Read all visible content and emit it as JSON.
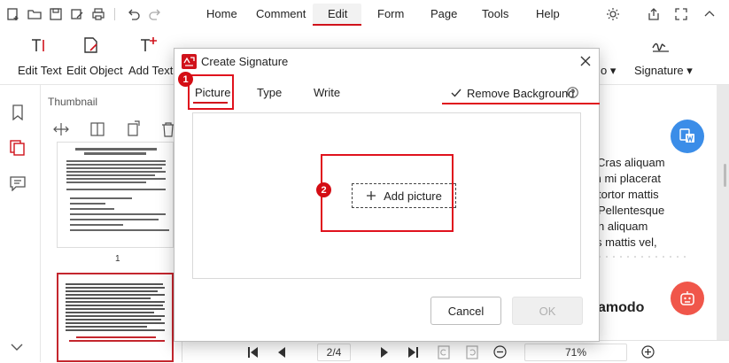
{
  "menu": {
    "items": [
      {
        "label": "Home"
      },
      {
        "label": "Comment"
      },
      {
        "label": "Edit"
      },
      {
        "label": "Form"
      },
      {
        "label": "Page"
      },
      {
        "label": "Tools"
      },
      {
        "label": "Help"
      }
    ],
    "active": "Edit"
  },
  "ribbon": {
    "edit_text": "Edit Text",
    "edit_object": "Edit Object",
    "add_text": "Add Text",
    "signature": "Signature ▾",
    "partial_label": "o ▾"
  },
  "thumbnail": {
    "title": "Thumbnail",
    "page_number": "1"
  },
  "dialog": {
    "title": "Create Signature",
    "tabs": [
      "Picture",
      "Type",
      "Write"
    ],
    "remove_background_label": "Remove Background",
    "remove_background_checked": true,
    "add_picture_label": "Add picture",
    "cancel_label": "Cancel",
    "ok_label": "OK",
    "callout_1": "1",
    "callout_2": "2"
  },
  "document": {
    "lines": [
      "Cras aliquam",
      "m mi placerat",
      "tortor mattis",
      "Pellentesque",
      "n aliquam",
      "s mattis vel,"
    ],
    "heading_fragment": "amodo"
  },
  "navigation": {
    "page_indicator": "2/4",
    "zoom": "71%"
  },
  "colors": {
    "accent_red": "#d0121b",
    "callout_red": "#e0121d",
    "blue_fab": "#3b8de8",
    "red_fab": "#f0564a"
  }
}
